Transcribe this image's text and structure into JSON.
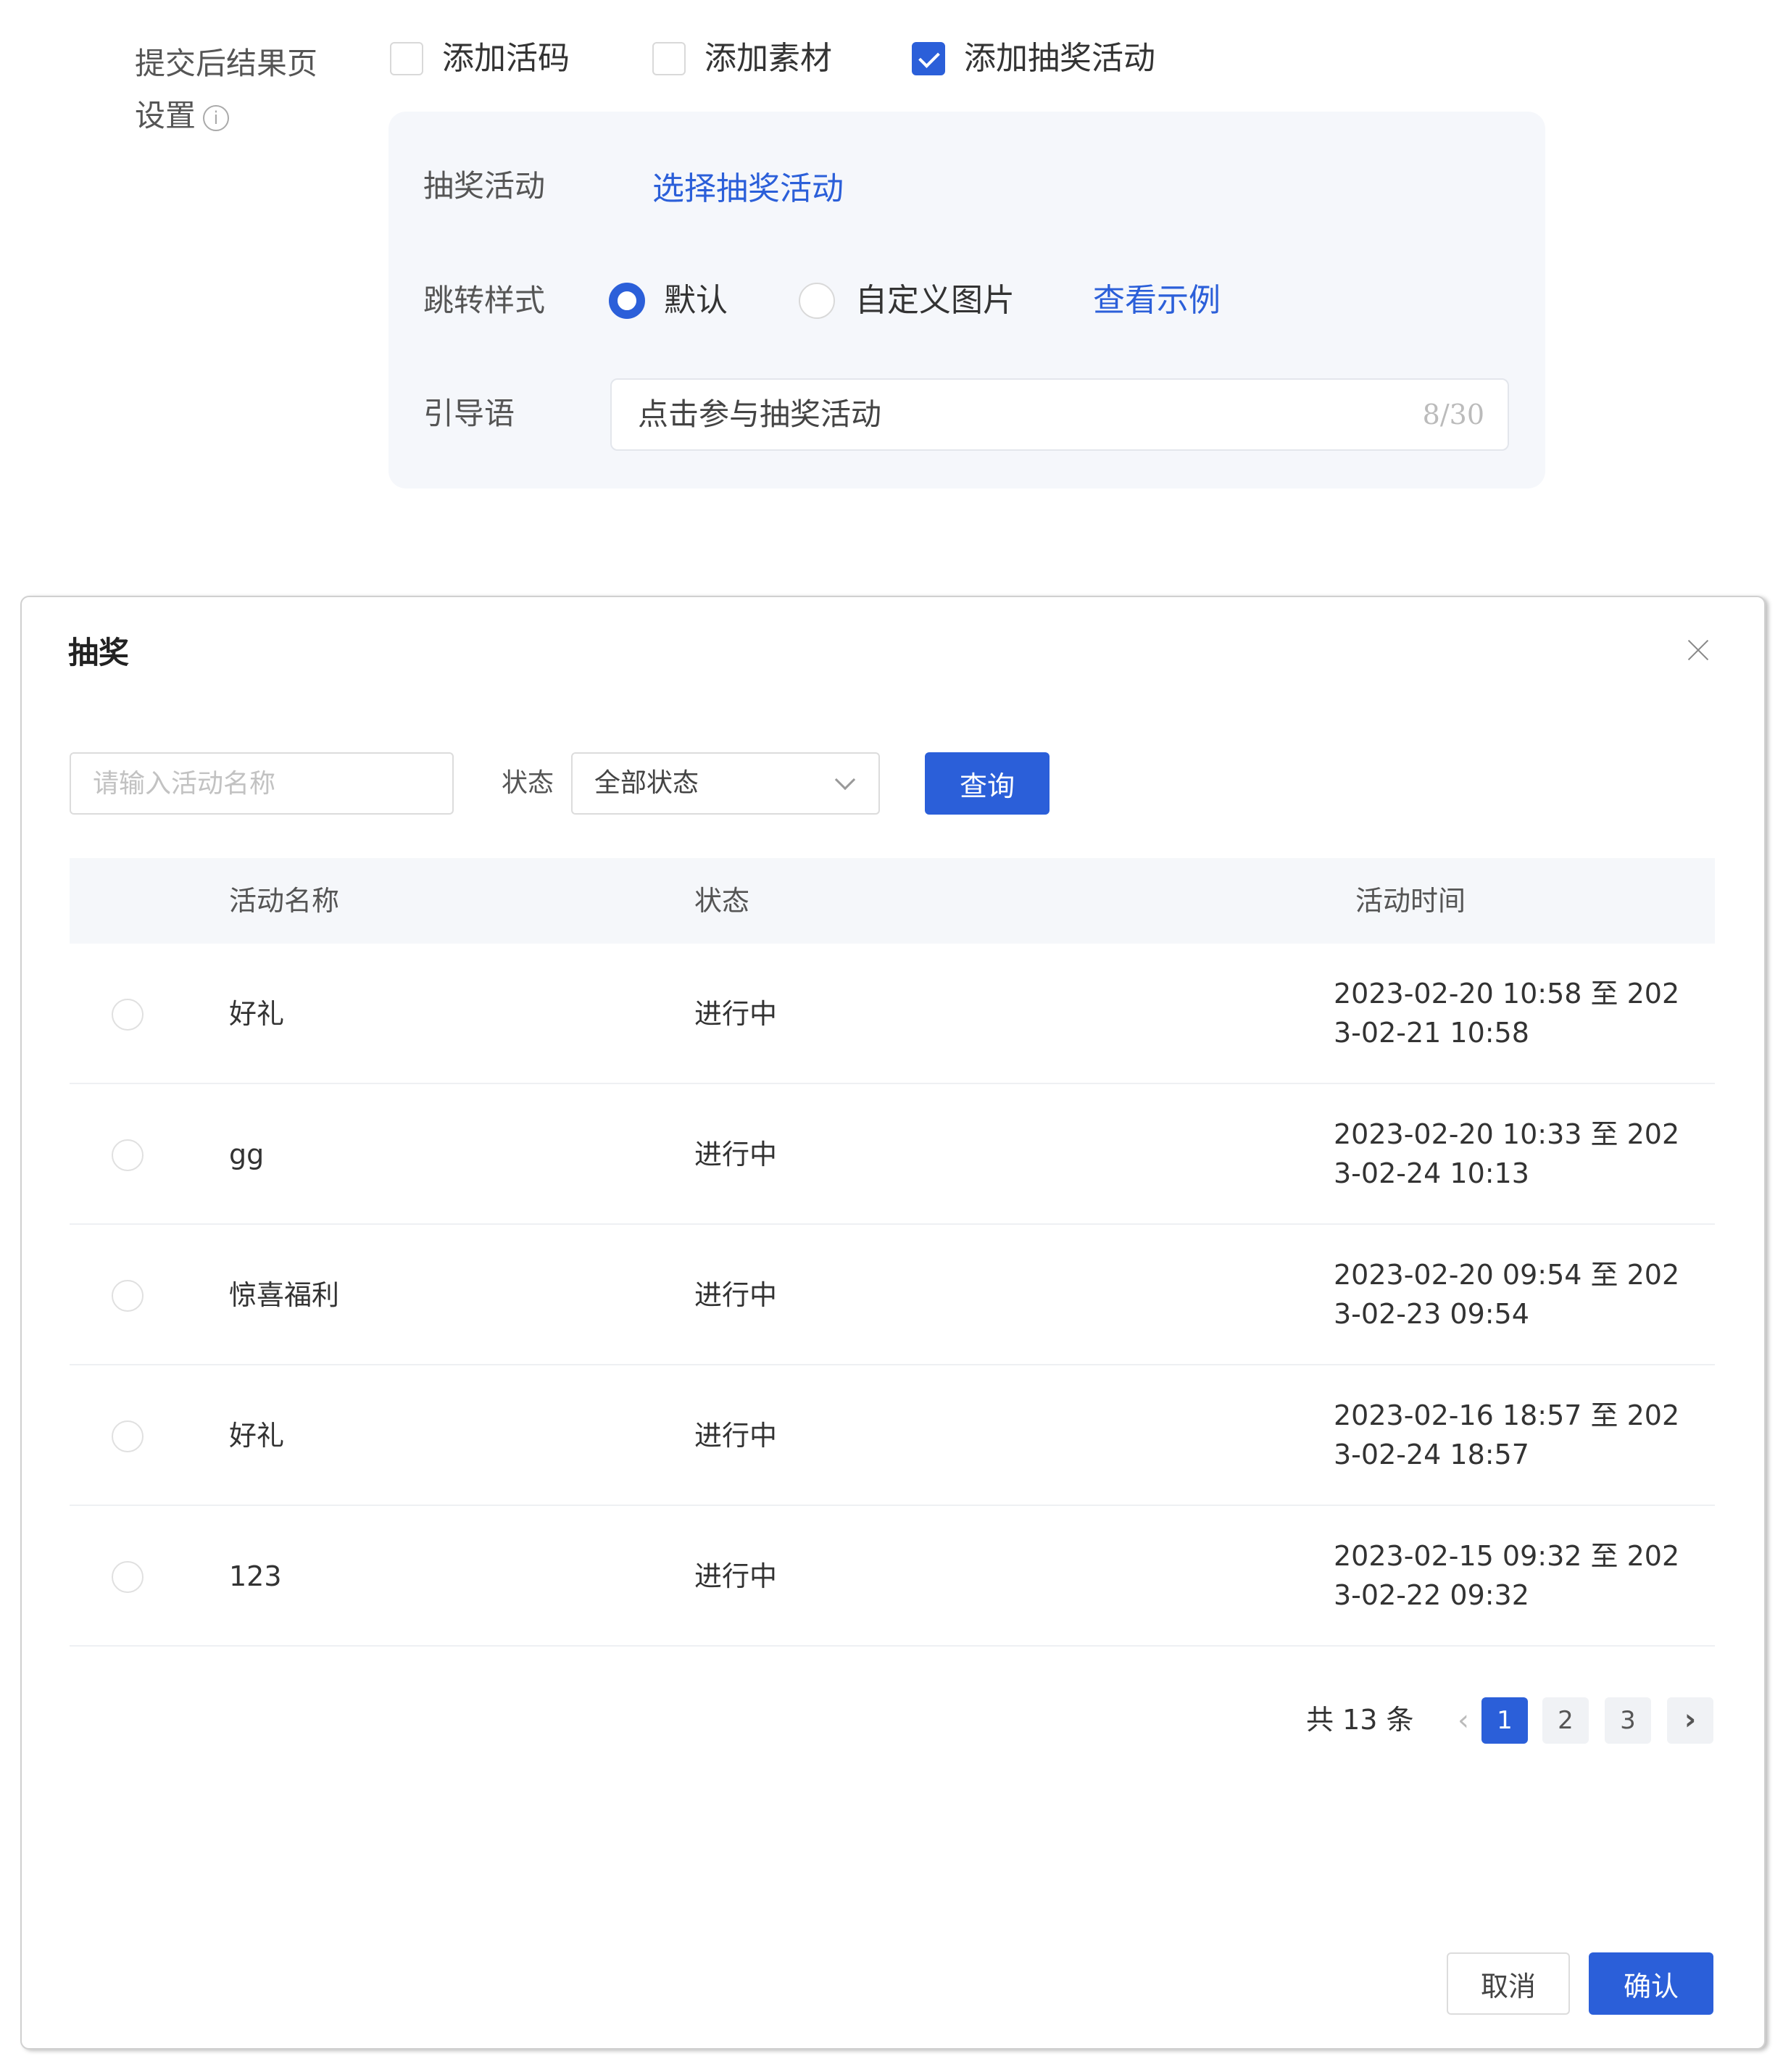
{
  "form": {
    "result_label": "提交后结果页设置",
    "info_icon_glyph": "i",
    "checkboxes": [
      {
        "label": "添加活码",
        "checked": false
      },
      {
        "label": "添加素材",
        "checked": false
      },
      {
        "label": "添加抽奖活动",
        "checked": true
      }
    ],
    "lottery_label": "抽奖活动",
    "select_lottery_link": "选择抽奖活动",
    "jump_style_label": "跳转样式",
    "radio_default": "默认",
    "radio_custom_image": "自定义图片",
    "view_example_link": "查看示例",
    "guide_label": "引导语",
    "guide_value": "点击参与抽奖活动",
    "guide_counter": "8/30"
  },
  "modal": {
    "title": "抽奖",
    "search_placeholder": "请输入活动名称",
    "status_label": "状态",
    "status_selected": "全部状态",
    "query_button": "查询",
    "columns": [
      "活动名称",
      "状态",
      "活动时间"
    ],
    "rows": [
      {
        "name": "好礼",
        "status": "进行中",
        "time": "2023-02-20 10:58 至 2023-02-21 10:58"
      },
      {
        "name": "gg",
        "status": "进行中",
        "time": "2023-02-20 10:33 至 2023-02-24 10:13"
      },
      {
        "name": "惊喜福利",
        "status": "进行中",
        "time": "2023-02-20 09:54 至 2023-02-23 09:54"
      },
      {
        "name": "好礼",
        "status": "进行中",
        "time": "2023-02-16 18:57 至 2023-02-24 18:57"
      },
      {
        "name": "123",
        "status": "进行中",
        "time": "2023-02-15 09:32 至 2023-02-22 09:32"
      }
    ],
    "pagination": {
      "total": "共 13 条",
      "prev": "‹",
      "pages": [
        "1",
        "2",
        "3"
      ],
      "current": "1",
      "next": "›"
    },
    "cancel_button": "取消",
    "confirm_button": "确认"
  },
  "colors": {
    "primary": "#2b5fd9",
    "panel_bg": "#f5f7fb",
    "header_bg": "#f5f7fa"
  }
}
